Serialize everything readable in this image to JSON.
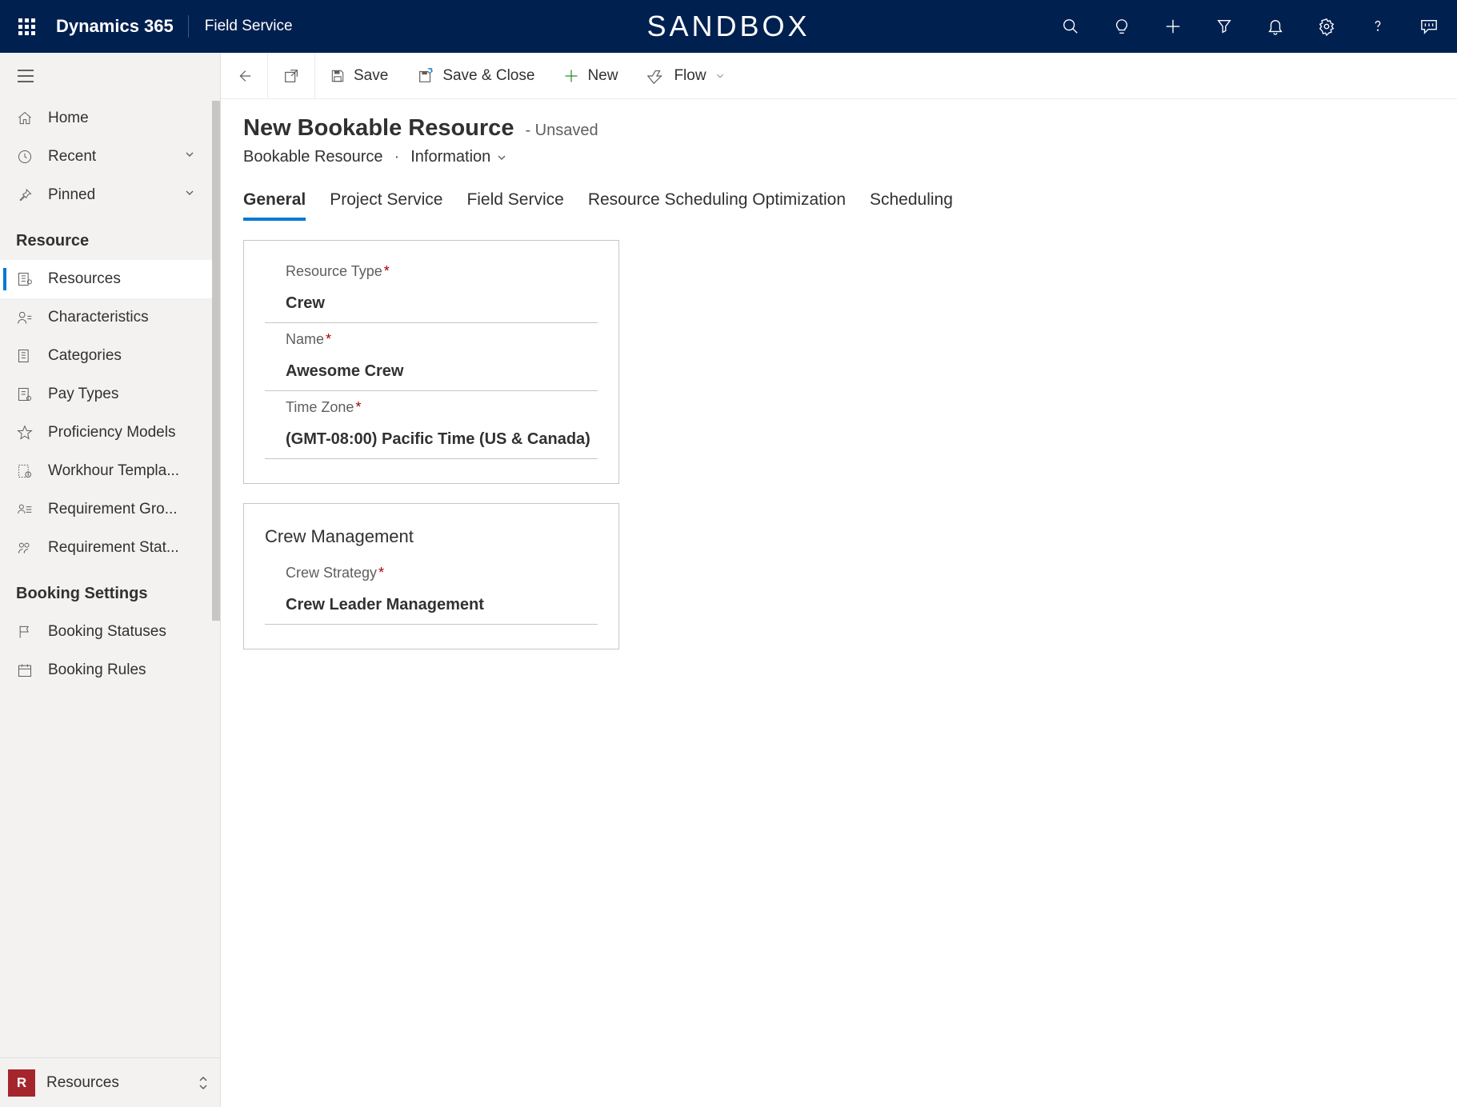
{
  "header": {
    "brand": "Dynamics 365",
    "module": "Field Service",
    "watermark": "SANDBOX"
  },
  "nav": {
    "top_items": [
      {
        "label": "Home",
        "chevron": false
      },
      {
        "label": "Recent",
        "chevron": true
      },
      {
        "label": "Pinned",
        "chevron": true
      }
    ],
    "groups": [
      {
        "header": "Resource",
        "items": [
          {
            "label": "Resources",
            "active": true
          },
          {
            "label": "Characteristics"
          },
          {
            "label": "Categories"
          },
          {
            "label": "Pay Types"
          },
          {
            "label": "Proficiency Models"
          },
          {
            "label": "Workhour Templa..."
          },
          {
            "label": "Requirement Gro..."
          },
          {
            "label": "Requirement Stat..."
          }
        ]
      },
      {
        "header": "Booking Settings",
        "items": [
          {
            "label": "Booking Statuses"
          },
          {
            "label": "Booking Rules"
          }
        ]
      }
    ],
    "area": {
      "badge": "R",
      "label": "Resources"
    }
  },
  "commandbar": {
    "save": "Save",
    "save_close": "Save & Close",
    "new": "New",
    "flow": "Flow"
  },
  "page": {
    "title": "New Bookable Resource",
    "status": "- Unsaved",
    "entity": "Bookable Resource",
    "form": "Information"
  },
  "tabs": [
    "General",
    "Project Service",
    "Field Service",
    "Resource Scheduling Optimization",
    "Scheduling"
  ],
  "sections": {
    "general": {
      "fields": [
        {
          "label": "Resource Type",
          "required": true,
          "value": "Crew"
        },
        {
          "label": "Name",
          "required": true,
          "value": "Awesome Crew"
        },
        {
          "label": "Time Zone",
          "required": true,
          "value": "(GMT-08:00) Pacific Time (US & Canada)"
        }
      ]
    },
    "crew": {
      "title": "Crew Management",
      "fields": [
        {
          "label": "Crew Strategy",
          "required": true,
          "value": "Crew Leader Management"
        }
      ]
    }
  }
}
